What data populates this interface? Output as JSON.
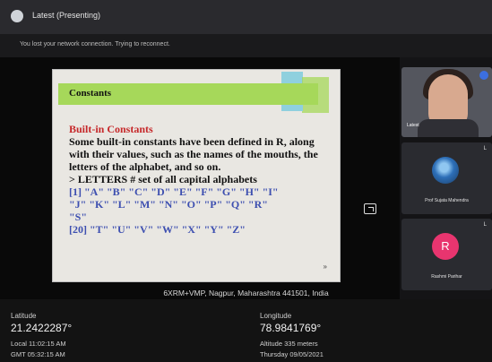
{
  "window": {
    "title": "Latest (Presenting)"
  },
  "banner": {
    "message": "You lost your network connection. Trying to reconnect."
  },
  "slide": {
    "title": "Constants",
    "heading": "Built-in Constants",
    "paragraph": "Some built-in constants have been defined in R, along with their values, such as the names of the mouths, the letters of the alphabet, and so on.",
    "command": "> LETTERS # set of all capital alphabets",
    "output_line1": "[1] \"A\" \"B\" \"C\" \"D\" \"E\" \"F\" \"G\" \"H\" \"I\"",
    "output_line2": "\"J\" \"K\" \"L\" \"M\" \"N\" \"O\" \"P\" \"Q\" \"R\"",
    "output_line3": "\"S\"",
    "output_line4": "[20] \"T\" \"U\" \"V\" \"W\" \"X\" \"Y\" \"Z\"",
    "marker": "»"
  },
  "participants": [
    {
      "name": "Latest",
      "type": "video"
    },
    {
      "name": "Prof Sujata Mahendra",
      "corner": "L"
    },
    {
      "name": "Rashmi Parihar",
      "initial": "R",
      "corner": "L"
    }
  ],
  "gps_overlay": {
    "location": "6XRM+VMP, Nagpur, Maharashtra 441501, India",
    "latitude_label": "Latitude",
    "latitude_value": "21.2422287°",
    "longitude_label": "Longitude",
    "longitude_value": "78.9841769°",
    "local_time": "Local 11:02:15 AM",
    "gmt_time": "GMT 05:32:15 AM",
    "altitude": "Altitude 335 meters",
    "date": "Thursday 09/05/2021"
  },
  "colors": {
    "title_bar_green": "#a6d85a",
    "heading_red": "#c6282a",
    "output_blue": "#3d4fb0",
    "avatar_pink": "#e8356f"
  }
}
